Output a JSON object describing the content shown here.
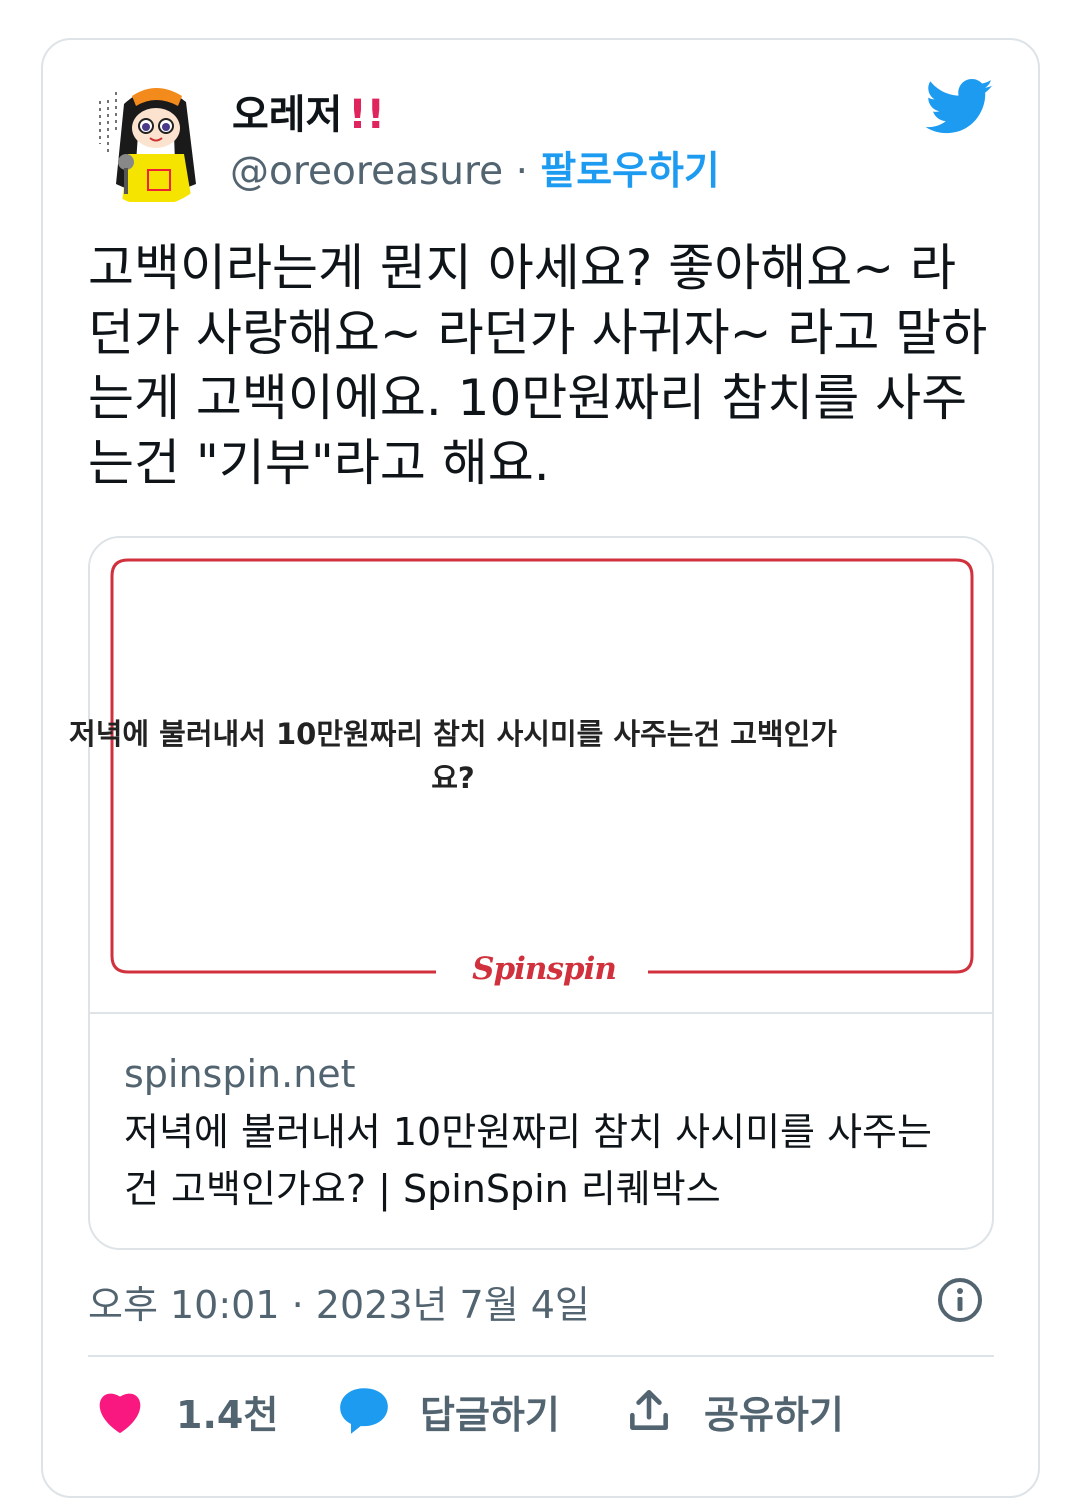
{
  "user": {
    "display_name": "오레저",
    "emoji": "!!",
    "handle": "@oreoreasure",
    "separator": "·",
    "follow_label": "팔로우하기"
  },
  "tweet": {
    "text": "고백이라는게 뭔지 아세요? 좋아해요~ 라던가 사랑해요~ 라던가 사귀자~ 라고 말하는게 고백이에요. 10만원짜리 참치를 사주는건 \"기부\"라고 해요."
  },
  "link_card": {
    "preview_text": "저녁에 불러내서 10만원짜리 참치 사시미를 사주는건 고백인가요?",
    "brand": "Spinspin",
    "domain": "spinspin.net",
    "title": "저녁에 불러내서 10만원짜리 참치 사시미를 사주는건 고백인가요? | SpinSpin 리퀘박스"
  },
  "meta": {
    "time": "오후 10:01",
    "separator": "·",
    "date": "2023년 7월 4일"
  },
  "actions": {
    "like_count": "1.4천",
    "reply_label": "답글하기",
    "share_label": "공유하기"
  },
  "colors": {
    "twitter_blue": "#1d9bf0",
    "like_pink": "#f91880",
    "brand_red": "#d0313c",
    "muted_text": "#536471"
  },
  "icons": {
    "logo": "twitter-bird-icon",
    "info": "info-icon",
    "like": "heart-icon",
    "reply": "speech-bubble-icon",
    "share": "share-upload-icon"
  }
}
